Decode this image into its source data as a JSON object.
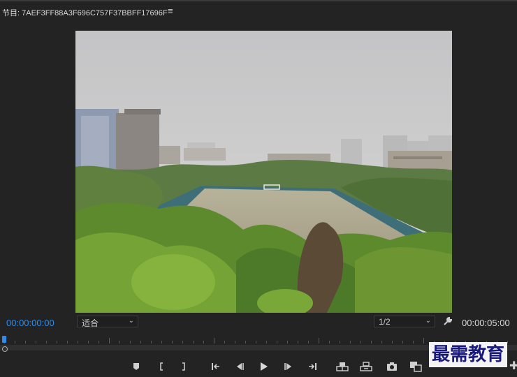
{
  "tab": {
    "title": "节目: 7AEF3FF88A3F696C757F37BBFF17696F",
    "menu_icon": "hamburger-menu-icon"
  },
  "monitor": {
    "timecode_current": "00:00:00:00",
    "zoom_select": {
      "value": "适合"
    },
    "resolution_select": {
      "value": "1/2"
    },
    "timecode_duration": "00:00:05:00",
    "settings_icon": "wrench-icon"
  },
  "transport": {
    "buttons": [
      {
        "name": "marker",
        "icon": "marker-icon"
      },
      {
        "name": "mark-in",
        "icon": "bracket-in-icon"
      },
      {
        "name": "mark-out",
        "icon": "bracket-out-icon"
      },
      {
        "name": "go-to-in",
        "icon": "go-to-in-icon"
      },
      {
        "name": "step-back",
        "icon": "step-back-icon"
      },
      {
        "name": "play",
        "icon": "play-icon"
      },
      {
        "name": "step-forward",
        "icon": "step-forward-icon"
      },
      {
        "name": "go-to-out",
        "icon": "go-to-out-icon"
      },
      {
        "name": "lift",
        "icon": "lift-icon"
      },
      {
        "name": "extract",
        "icon": "extract-icon"
      },
      {
        "name": "export-frame",
        "icon": "camera-icon"
      },
      {
        "name": "comparison-view",
        "icon": "comparison-view-icon"
      }
    ]
  },
  "watermark": {
    "text": "最需教育"
  },
  "colors": {
    "accent": "#2d8ceb",
    "panel_bg": "#232323"
  }
}
